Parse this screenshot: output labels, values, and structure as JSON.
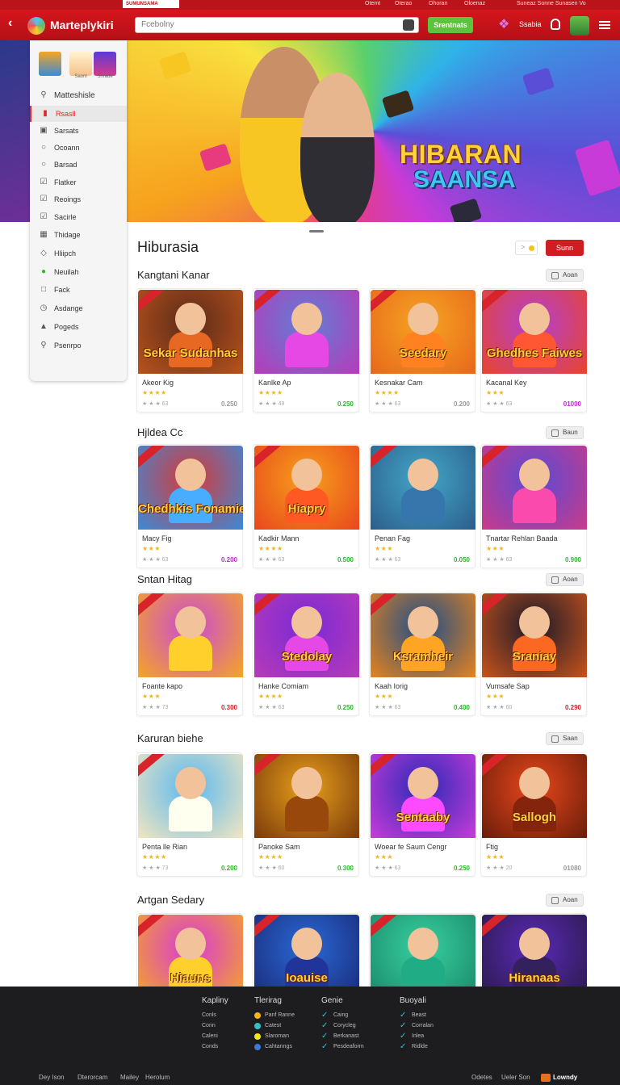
{
  "top_strip": {
    "badge": "SUMUNSAMA",
    "links": [
      "Otemt",
      "Oterao",
      "Ohoran",
      "Oloenaz"
    ],
    "promo": "Suneaz Sonne Sunasen Vo"
  },
  "header": {
    "app_title": "Marteplykiri",
    "search_placeholder": "Fcebolny",
    "green_button": "Srentnats",
    "user_label": "Ssabia"
  },
  "hero": {
    "title": "HIBARAN",
    "subtitle": "SAANSA"
  },
  "sidebar": {
    "thumbs": [
      "",
      "Saonl",
      "Snrade"
    ],
    "header_item": "Matteshisle",
    "items": [
      {
        "label": "Rsasll",
        "icon": "home-icon",
        "active": true
      },
      {
        "label": "Sarsats",
        "icon": "games-icon",
        "active": false
      },
      {
        "label": "Ocoann",
        "icon": "circle-icon",
        "active": false
      },
      {
        "label": "Barsad",
        "icon": "circle-icon",
        "active": false
      },
      {
        "label": "Flatker",
        "icon": "checkbox-icon",
        "active": false
      },
      {
        "label": "Reoings",
        "icon": "checkbox-icon",
        "active": false
      },
      {
        "label": "Sacirle",
        "icon": "checkbox-icon",
        "active": false
      },
      {
        "label": "Thidage",
        "icon": "puzzle-icon",
        "active": false
      },
      {
        "label": "Hliipch",
        "icon": "tag-icon",
        "active": false
      },
      {
        "label": "Neuilah",
        "icon": "green-leaf-icon",
        "active": false
      },
      {
        "label": "Fack",
        "icon": "square-icon",
        "active": false
      },
      {
        "label": "Asdange",
        "icon": "clock-icon",
        "active": false
      },
      {
        "label": "Pogeds",
        "icon": "chart-icon",
        "active": false
      },
      {
        "label": "Psenrpo",
        "icon": "search-icon",
        "active": false
      }
    ]
  },
  "main": {
    "page_title": "Hiburasia",
    "filter_label": ">",
    "primary_button": "Sunn",
    "sections": [
      {
        "title": "Kangtani Kanar",
        "button": "Aoan",
        "cards": [
          {
            "name": "Akeor Kig",
            "art": "Sekar Sudanhas",
            "stars": "★★★★",
            "rating": "★ ★ ★ 63",
            "price": "0.250",
            "price_color": "#9a9a9a",
            "palette": [
              "#5b2a1a",
              "#b9531b"
            ]
          },
          {
            "name": "Kanlke Ap",
            "art": "",
            "stars": "★★★★",
            "rating": "★ ★ ★ 49",
            "price": "0.250",
            "price_color": "#2eb82e",
            "palette": [
              "#5f7fd6",
              "#b83ab8"
            ]
          },
          {
            "name": "Kesnakar Cam",
            "art": "Seedary",
            "stars": "★★★★",
            "rating": "★ ★ ★ 63",
            "price": "0.200",
            "price_color": "#9a9a9a",
            "palette": [
              "#f5a623",
              "#e8671a"
            ]
          },
          {
            "name": "Kacanal Key",
            "art": "Ghedhes Faiwes",
            "stars": "★★★",
            "rating": "★ ★ ★ 63",
            "price": "01000",
            "price_color": "#c02ad0",
            "palette": [
              "#b43fd0",
              "#e8452a"
            ]
          }
        ]
      },
      {
        "title": "Hjldea Cc",
        "button": "Baun",
        "cards": [
          {
            "name": "Macy Fig",
            "art": "Chedhkis Fonamie",
            "stars": "★★★",
            "rating": "★ ★ ★ 63",
            "price": "0.200",
            "price_color": "#c02ad0",
            "palette": [
              "#d83a3a",
              "#3a8ad8"
            ]
          },
          {
            "name": "Kadkir Mann",
            "art": "Hiapry",
            "stars": "★★★★",
            "rating": "★ ★ ★ 63",
            "price": "0.500",
            "price_color": "#2eb82e",
            "palette": [
              "#f7a01c",
              "#e8471c"
            ]
          },
          {
            "name": "Penan Fag",
            "art": "",
            "stars": "★★★",
            "rating": "★ ★ ★ 63",
            "price": "0.050",
            "price_color": "#2eb82e",
            "palette": [
              "#44a7c9",
              "#2b5e8a"
            ]
          },
          {
            "name": "Tnartar Rehlan Baada",
            "art": "",
            "stars": "★★★",
            "rating": "★ ★ ★ 63",
            "price": "0.900",
            "price_color": "#2eb82e",
            "palette": [
              "#5a4ad6",
              "#c93b8a"
            ]
          }
        ]
      },
      {
        "title": "Sntan Hitag",
        "button": "Aoan",
        "cards": [
          {
            "name": "Foante kapo",
            "art": "",
            "stars": "★★★",
            "rating": "★ ★ ★ 73",
            "price": "0.300",
            "price_color": "#d8232a",
            "palette": [
              "#c94ad6",
              "#f5a623"
            ]
          },
          {
            "name": "Hanke Comiam",
            "art": "Stedolay",
            "stars": "★★★★",
            "rating": "★ ★ ★ 63",
            "price": "0.250",
            "price_color": "#2eb82e",
            "palette": [
              "#7a2ad6",
              "#b83ab8"
            ]
          },
          {
            "name": "Kaah Iorig",
            "art": "Ksramheir",
            "stars": "★★★",
            "rating": "★ ★ ★ 63",
            "price": "0.400",
            "price_color": "#2eb82e",
            "palette": [
              "#1d4e8a",
              "#e8831c"
            ]
          },
          {
            "name": "Vumsafe Sap",
            "art": "Sraniay",
            "stars": "★★★",
            "rating": "★ ★ ★ 60",
            "price": "0.290",
            "price_color": "#d8232a",
            "palette": [
              "#1a1a2a",
              "#c9531b"
            ]
          }
        ]
      },
      {
        "title": "Karuran biehe",
        "button": "Saan",
        "cards": [
          {
            "name": "Penta lle Rian",
            "art": "",
            "stars": "★★★★",
            "rating": "★ ★ ★ 73",
            "price": "0.200",
            "price_color": "#2eb82e",
            "palette": [
              "#5ab8f0",
              "#f2e6c0"
            ]
          },
          {
            "name": "Panoke Sam",
            "art": "",
            "stars": "★★★★",
            "rating": "★ ★ ★ 60",
            "price": "0.300",
            "price_color": "#2eb82e",
            "palette": [
              "#e8a01c",
              "#7a3a0a"
            ]
          },
          {
            "name": "Woear fe Saum Cengr",
            "art": "Sentaaby",
            "stars": "★★★",
            "rating": "★ ★ ★ 63",
            "price": "0.250",
            "price_color": "#2eb82e",
            "palette": [
              "#2a2ab8",
              "#c93bd8"
            ]
          },
          {
            "name": "Ftig",
            "art": "Sallogh",
            "stars": "★★★",
            "rating": "★ ★ ★ 20",
            "price": "01080",
            "price_color": "#9a9a9a",
            "palette": [
              "#e8471c",
              "#6a1d0a"
            ]
          }
        ]
      },
      {
        "title": "Artgan Sedary",
        "button": "Aoan",
        "cards": [
          {
            "name": "",
            "art": "Hiauns",
            "stars": "",
            "rating": "",
            "price": "",
            "price_color": "#2eb82e",
            "palette": [
              "#d83ad8",
              "#f5a623"
            ]
          },
          {
            "name": "",
            "art": "Ioauise",
            "stars": "",
            "rating": "",
            "price": "",
            "price_color": "#2eb82e",
            "palette": [
              "#2a6ad6",
              "#1a2a7a"
            ]
          },
          {
            "name": "",
            "art": "",
            "stars": "",
            "rating": "",
            "price": "",
            "price_color": "#2eb82e",
            "palette": [
              "#38d0a0",
              "#1a8a6a"
            ]
          },
          {
            "name": "",
            "art": "Hiranaas",
            "stars": "",
            "rating": "",
            "price": "",
            "price_color": "#2eb82e",
            "palette": [
              "#5a2ab8",
              "#2a1a4a"
            ]
          }
        ]
      }
    ]
  },
  "footer": {
    "columns": [
      {
        "title": "Kapliny",
        "marker": "none",
        "items": [
          "Conls",
          "Conn",
          "Caleni",
          "Conds"
        ]
      },
      {
        "title": "Tlerirag",
        "marker": "dot",
        "items": [
          "Panf Ranne",
          "Catest",
          "Slaroman",
          "Cahtanngs"
        ]
      },
      {
        "title": "Genie",
        "marker": "check",
        "items": [
          "Caing",
          "Corycleg",
          "Berkanast",
          "Pesdeaform"
        ]
      },
      {
        "title": "Buoyali",
        "marker": "check",
        "items": [
          "Beast",
          "Corralan",
          "Inlea",
          "Ridlde"
        ]
      }
    ],
    "dot_colors": [
      "#f2b51c",
      "#35c0c8",
      "#f2e61c",
      "#3a7ad8"
    ],
    "bottom_left": [
      "Dey Ison",
      "Dterorcam",
      "Mailey",
      "Herolum"
    ],
    "bottom_right": [
      "Odetes",
      "Ueler Son"
    ],
    "brand": "Lowndy"
  }
}
